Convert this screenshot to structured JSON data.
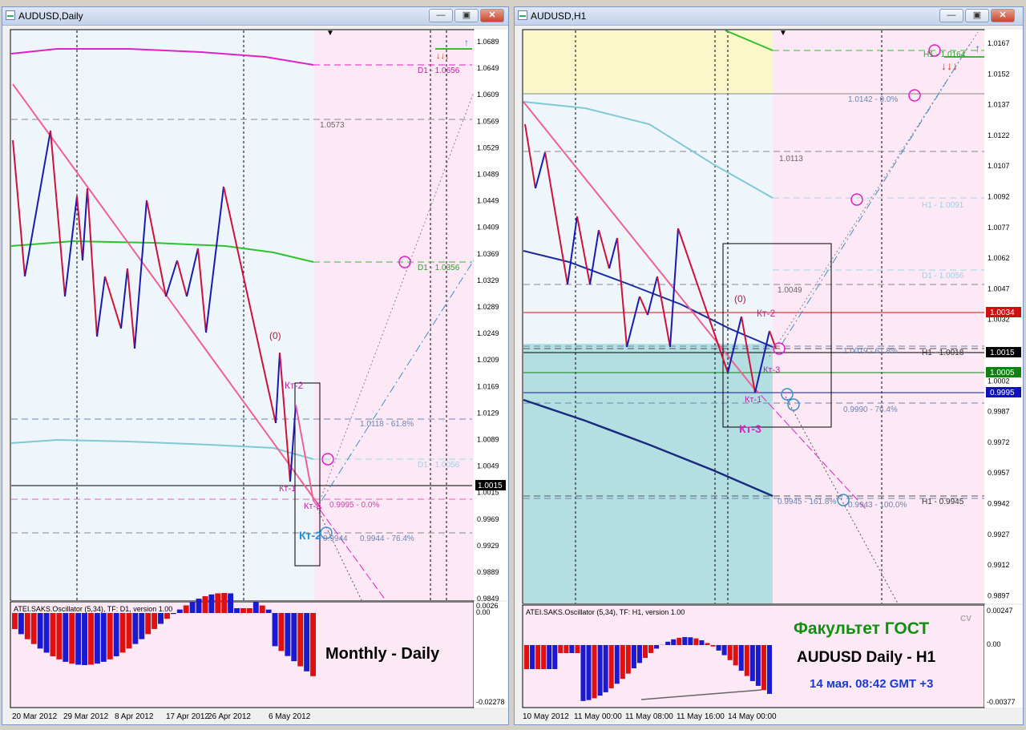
{
  "left_window": {
    "title": "AUDUSD,Daily",
    "price_axis": [
      "1.0689",
      "1.0649",
      "1.0609",
      "1.0569",
      "1.0529",
      "1.0489",
      "1.0449",
      "1.0409",
      "1.0369",
      "1.0329",
      "1.0289",
      "1.0249",
      "1.0209",
      "1.0169",
      "1.0129",
      "1.0089",
      "1.0049",
      "1.0015",
      "0.9969",
      "0.9929",
      "0.9889",
      "0.9849"
    ],
    "current_price": "1.0015",
    "date_axis": [
      "20 Mar 2012",
      "29 Mar 2012",
      "8 Apr 2012",
      "17 Apr 2012",
      "26 Apr 2012",
      "6 May 2012"
    ],
    "levels": {
      "d1_top": "D1 - 1.0656",
      "level_1_0573": "1.0573",
      "d1_mid": "D1 - 1.0356",
      "fib_618": "1.0118 - 61.8%",
      "d1_low": "D1 - 1.0056",
      "fib_0": "0.9995 - 0.0%",
      "fib_764": "0.9944 - 76.4%",
      "small_0944": "0.9944"
    },
    "wave_labels": {
      "zero": "(0)",
      "kt2": "Кт-2",
      "kt1": "Кт-1",
      "kt3": "Кт-3",
      "kt2_blue": "Кт-2"
    },
    "oscillator": {
      "caption": "ATEI.SAKS.Oscillator (5,34), TF: D1, version 1.00",
      "axis": [
        "0.0026",
        "0.00",
        "-0.02278"
      ]
    },
    "overlay_text": "Monthly - Daily"
  },
  "right_window": {
    "title": "AUDUSD,H1",
    "price_axis": [
      "1.0167",
      "1.0152",
      "1.0137",
      "1.0122",
      "1.0107",
      "1.0092",
      "1.0077",
      "1.0062",
      "1.0047",
      "1.0032",
      "1.0017",
      "1.0002",
      "0.9987",
      "0.9972",
      "0.9957",
      "0.9942",
      "0.9927",
      "0.9912",
      "0.9897"
    ],
    "price_tags": {
      "red": "1.0034",
      "black": "1.0015",
      "green": "1.0005",
      "blue": "0.9995"
    },
    "date_axis": [
      "10 May 2012",
      "11 May 00:00",
      "11 May 08:00",
      "11 May 16:00",
      "14 May 00:00"
    ],
    "levels": {
      "h1_top": "H1 - 1.0164",
      "fib_0": "1.0142 - 0.0%",
      "level_1_0113": "1.0113",
      "h1_1091": "H1 - 1.0091",
      "d1_1056": "D1 - 1.0056",
      "level_1_0049": "1.0049",
      "fib_618": "1.0019 - 61.8%",
      "h1_1018": "H1 - 1.0018",
      "fib_764": "0.9990 - 76.4%",
      "fib_1618": "0.9945 - 161.8%",
      "fib_100": "0.9943 - 100.0%",
      "h1_9945": "H1 - 0.9945"
    },
    "wave_labels": {
      "zero": "(0)",
      "kt2": "Кт-2",
      "kt3": "Кт-3",
      "kt1": "Кт-1",
      "kt3_big": "Кт-3"
    },
    "oscillator": {
      "caption": "ATEI.SAKS.Oscillator (5,34), TF: H1, version 1.00",
      "axis": [
        "0.00247",
        "0.00",
        "-0.00377"
      ]
    },
    "overlay": {
      "faculty": "Факультет ГОСТ",
      "cv": "CV",
      "pair": "AUDUSD Daily - H1",
      "time": "14 мая. 08:42 GMT +3"
    }
  },
  "window_buttons": {
    "minimize": "—",
    "restore": "▣",
    "close": "✕"
  },
  "colors": {
    "bull": "#1a1ab0",
    "bear": "#d0103a",
    "trend": "#f06090",
    "zone_pink": "#fde8f6",
    "zone_blue": "#eef6fb",
    "zone_yellow": "#faf7c8",
    "zone_teal": "#b4dfe2"
  }
}
